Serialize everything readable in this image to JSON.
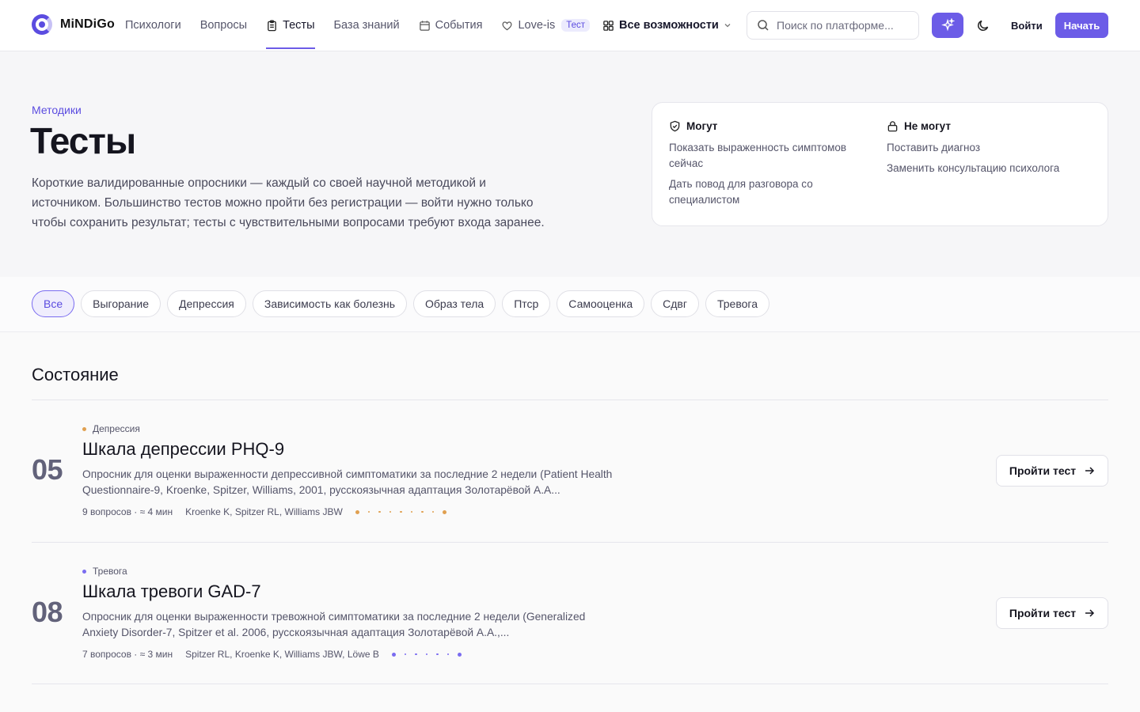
{
  "brand": {
    "name": "MiNDiGo"
  },
  "nav": {
    "psychologists": "Психологи",
    "questions": "Вопросы",
    "tests": "Тесты",
    "knowledge": "База знаний",
    "events": "События",
    "loveis": "Love-is",
    "loveis_badge": "Тест",
    "all_features": "Все возможности"
  },
  "search": {
    "placeholder": "Поиск по платформе..."
  },
  "header": {
    "login": "Войти",
    "start": "Начать"
  },
  "hero": {
    "eyebrow": "Методики",
    "title": "Тесты",
    "description": "Короткие валидированные опросники — каждый со своей научной методикой и источником. Большинство тестов можно пройти без регистрации — войти нужно только чтобы сохранить результат; тесты с чувствительными вопросами требуют входа заранее."
  },
  "info": {
    "can": {
      "title": "Могут",
      "items": [
        "Показать выраженность симптомов сейчас",
        "Дать повод для разговора со специалистом"
      ]
    },
    "cannot": {
      "title": "Не могут",
      "items": [
        "Поставить диагноз",
        "Заменить консультацию психолога"
      ]
    }
  },
  "filters": [
    "Все",
    "Выгорание",
    "Депрессия",
    "Зависимость как болезнь",
    "Образ тела",
    "Птср",
    "Самооценка",
    "Сдвг",
    "Тревога"
  ],
  "section": {
    "title": "Состояние"
  },
  "tests": [
    {
      "number": "05",
      "category": "Депрессия",
      "category_color": "#e0a050",
      "title": "Шкала депрессии PHQ-9",
      "description": "Опросник для оценки выраженности депрессивной симптоматики за последние 2 недели (Patient Health Questionnaire-9, Kroenke, Spitzer, Williams, 2001, русскоязычная адаптация Золотарёвой А.А...",
      "meta": "9 вопросов · ≈ 4 мин",
      "authors": "Kroenke K, Spitzer RL, Williams JBW",
      "question_count": 9,
      "button": "Пройти тест"
    },
    {
      "number": "08",
      "category": "Тревога",
      "category_color": "#7a6cf0",
      "title": "Шкала тревоги GAD-7",
      "description": "Опросник для оценки выраженности тревожной симптоматики за последние 2 недели (Generalized Anxiety Disorder-7, Spitzer et al. 2006, русскоязычная адаптация Золотарёвой А.А.,...",
      "meta": "7 вопросов · ≈ 3 мин",
      "authors": "Spitzer RL, Kroenke K, Williams JBW, Löwe B",
      "question_count": 7,
      "button": "Пройти тест"
    }
  ]
}
